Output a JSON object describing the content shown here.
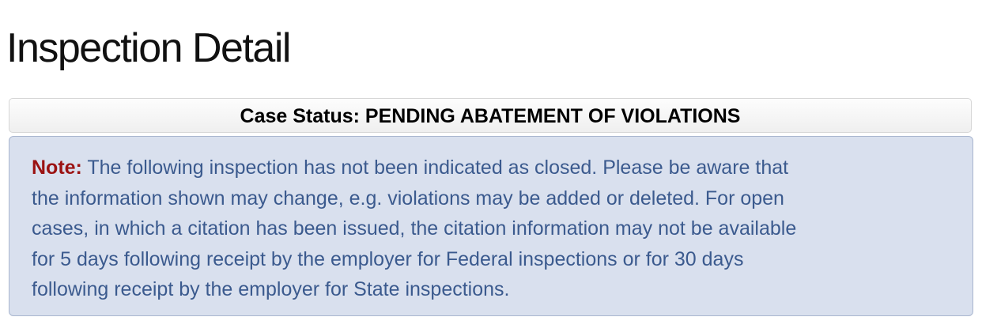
{
  "page": {
    "title": "Inspection Detail"
  },
  "case_status": {
    "label": "Case Status:",
    "value": "PENDING ABATEMENT OF VIOLATIONS"
  },
  "note": {
    "label": "Note:",
    "lines": [
      " The following inspection has not been indicated as closed. Please be aware that",
      "the information shown may change, e.g. violations may be added or deleted. For open",
      "cases, in which a citation has been issued, the citation information may not be available",
      "for 5 days following receipt by the employer for Federal inspections or for 30 days",
      "following receipt by the employer for State inspections."
    ]
  },
  "colors": {
    "note_background": "#d9e0ee",
    "note_border": "#a9b6cf",
    "note_text": "#3b5a8e",
    "note_label": "#9b1212",
    "status_background": "#f4f4f4"
  }
}
